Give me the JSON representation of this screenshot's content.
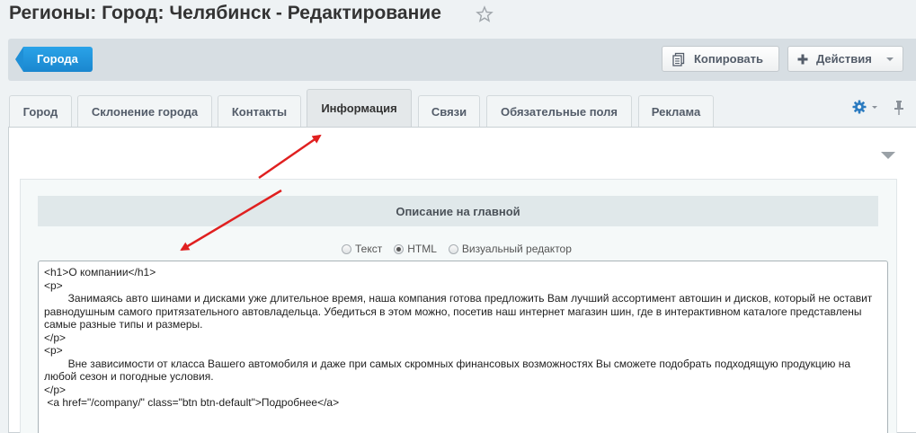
{
  "header": {
    "title": "Регионы: Город: Челябинск - Редактирование",
    "star_icon": "star-icon"
  },
  "toolbar": {
    "back_label": "Города",
    "copy_label": "Копировать",
    "copy_icon": "copy-icon",
    "actions_label": "Действия",
    "actions_icon": "plus-icon"
  },
  "tabs": [
    {
      "label": "Город"
    },
    {
      "label": "Склонение города"
    },
    {
      "label": "Контакты"
    },
    {
      "label": "Информация",
      "active": true
    },
    {
      "label": "Связи"
    },
    {
      "label": "Обязательные поля"
    },
    {
      "label": "Реклама"
    }
  ],
  "tab_tools": {
    "settings_icon": "gear-icon",
    "pin_icon": "pin-icon"
  },
  "section": {
    "title": "Описание на главной",
    "modes": [
      {
        "label": "Текст",
        "checked": false
      },
      {
        "label": "HTML",
        "checked": true
      },
      {
        "label": "Визуальный редактор",
        "checked": false
      }
    ],
    "editor_lines": [
      "<h1>О компании</h1>",
      "<p>",
      "        Занимаясь авто шинами и дисками уже длительное время, наша компания готова предложить Вам лучший ассортимент автошин и дисков, который не оставит равнодушным самого притязательного автовладельца. Убедиться в этом можно, посетив наш интернет магазин шин, где в интерактивном каталоге представлены самые разные типы и размеры.",
      "</p>",
      "<p>",
      "        Вне зависимости от класса Вашего автомобиля и даже при самых скромных финансовых возможностях Вы сможете подобрать подходящую продукцию на любой сезон и погодные условия.",
      "</p>",
      " <a href=\"/company/\" class=\"btn btn-default\">Подробнее</a>"
    ]
  },
  "colors": {
    "accent": "#1a87cf",
    "annotation_arrow": "#e02020"
  }
}
